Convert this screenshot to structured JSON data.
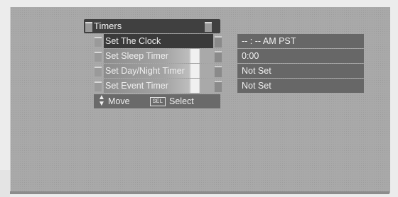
{
  "menu": {
    "title": "Timers",
    "items": [
      {
        "label": "Set The Clock",
        "selected": true
      },
      {
        "label": "Set Sleep Timer",
        "selected": false
      },
      {
        "label": "Set Day/Night Timer",
        "selected": false
      },
      {
        "label": "Set Event Timer",
        "selected": false
      }
    ]
  },
  "values": [
    "-- : --  AM PST",
    "0:00",
    "Not Set",
    "Not Set"
  ],
  "help": {
    "move_icon": "up-down-arrows-icon",
    "move_label": "Move",
    "select_key": "SEL",
    "select_label": "Select"
  }
}
